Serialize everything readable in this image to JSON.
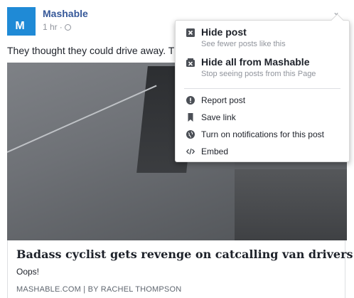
{
  "post": {
    "page_name": "Mashable",
    "avatar_letter": "M",
    "time": "1 hr",
    "separator": "·",
    "text": "They thought they could drive away. T"
  },
  "link": {
    "title": "Badass cyclist gets revenge on catcalling van drivers",
    "description": "Oops!",
    "source": "MASHABLE.COM | BY RACHEL THOMPSON"
  },
  "menu": {
    "hide_post": {
      "title": "Hide post",
      "subtitle": "See fewer posts like this"
    },
    "hide_all": {
      "title": "Hide all from Mashable",
      "subtitle": "Stop seeing posts from this Page"
    },
    "items": [
      {
        "label": "Report post",
        "icon": "report-icon"
      },
      {
        "label": "Save link",
        "icon": "bookmark-icon"
      },
      {
        "label": "Turn on notifications for this post",
        "icon": "globe-notification-icon"
      },
      {
        "label": "Embed",
        "icon": "code-icon"
      }
    ]
  },
  "colors": {
    "brand": "#365899",
    "avatar_bg": "#1f8ad6",
    "muted": "#90949c"
  }
}
